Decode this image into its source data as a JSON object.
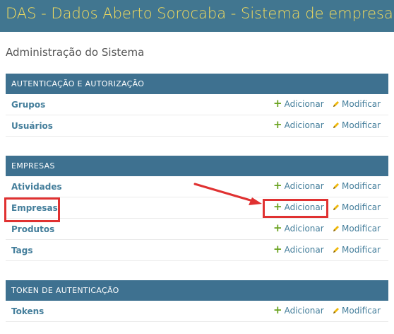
{
  "site": {
    "title": "DAS - Dados Aberto Sorocaba - Sistema de empresas"
  },
  "page": {
    "title": "Administração do Sistema"
  },
  "actions": {
    "add_label": "Adicionar",
    "change_label": "Modificar"
  },
  "modules": [
    {
      "caption": "AUTENTICAÇÃO E AUTORIZAÇÃO",
      "rows": [
        {
          "label": "Grupos"
        },
        {
          "label": "Usuários"
        }
      ]
    },
    {
      "caption": "EMPRESAS",
      "rows": [
        {
          "label": "Atividades"
        },
        {
          "label": "Empresas"
        },
        {
          "label": "Produtos"
        },
        {
          "label": "Tags"
        }
      ]
    },
    {
      "caption": "TOKEN DE AUTENTICAÇÃO",
      "rows": [
        {
          "label": "Tokens"
        }
      ]
    }
  ],
  "colors": {
    "header_bg": "#417690",
    "site_title": "#f5dd5d",
    "module_caption_bg": "#3e7190",
    "link": "#447e9b",
    "add_icon": "#6aa320",
    "highlight": "#e03131"
  },
  "icons": {
    "add": "plus-icon",
    "change": "pencil-icon",
    "annotation": "arrow-icon"
  }
}
